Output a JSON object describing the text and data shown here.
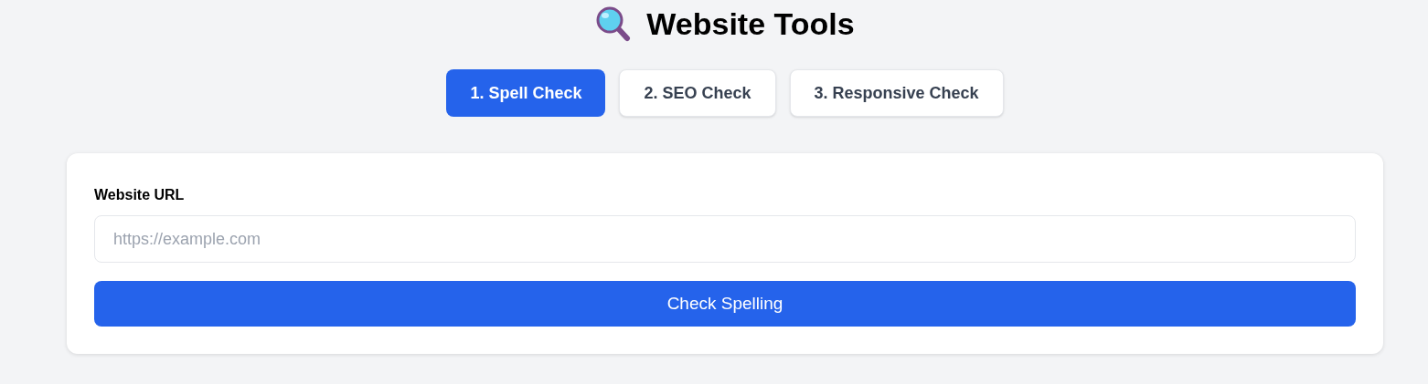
{
  "title": "Website Tools",
  "tabs": [
    {
      "label": "1. Spell Check",
      "selected": true
    },
    {
      "label": "2. SEO Check",
      "selected": false
    },
    {
      "label": "3. Responsive Check",
      "selected": false
    }
  ],
  "form": {
    "label": "Website URL",
    "placeholder": "https://example.com",
    "button": "Check Spelling"
  }
}
